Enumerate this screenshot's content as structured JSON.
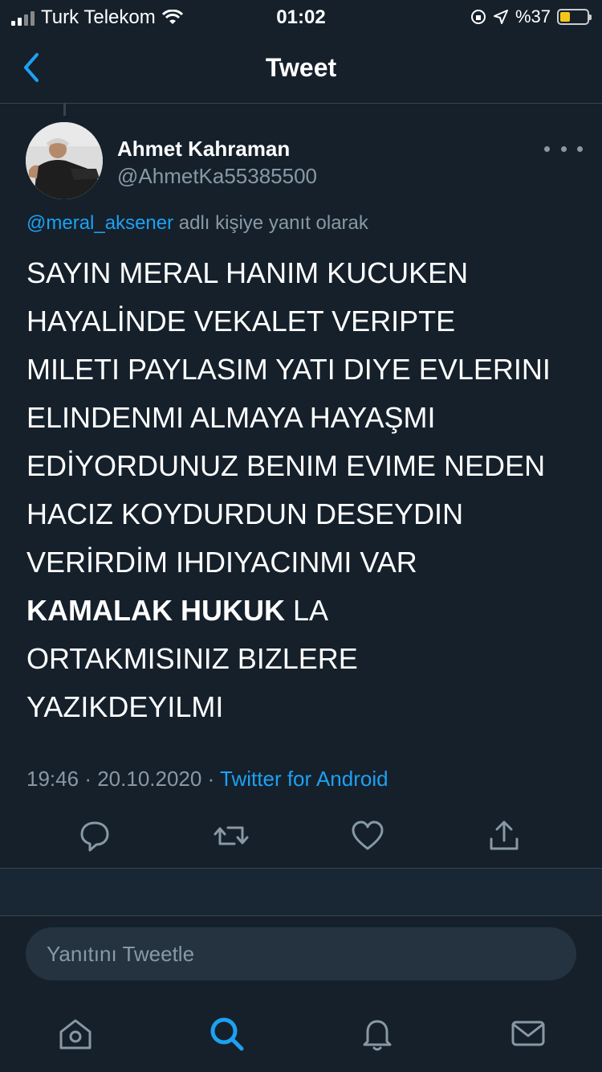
{
  "status_bar": {
    "carrier": "Turk Telekom",
    "time": "01:02",
    "battery": "%37",
    "battery_level": 0.37
  },
  "nav": {
    "back_icon": "chevron-left-icon",
    "title": "Tweet"
  },
  "tweet": {
    "author_name": "Ahmet Kahraman",
    "author_handle": "@AhmetKa55385500",
    "reply_mention": "@meral_aksener",
    "reply_suffix": "adlı kişiye yanıt olarak",
    "lines": [
      "SAYIN MERAL HANIM  KUCUKEN",
      "HAYALİNDE VEKALET VERIPTE",
      "MILETI PAYLASIM YATI DIYE EVLERINI",
      "ELINDENMI ALMAYA HAYAŞMI",
      "EDİYORDUNUZ BENIM EVIME NEDEN",
      "HACIZ KOYDURDUN DESEYDIN",
      "VERİRDİM IHDIYACINMI VAR"
    ],
    "bold_part": "KAMALAK HUKUK",
    "after_bold": " LA",
    "lines_end": [
      "ORTAKMISINIZ BIZLERE",
      "YAZIKDEYILMI"
    ],
    "time": "19:46",
    "separator": "·",
    "date": "20.10.2020",
    "source": "Twitter for Android"
  },
  "actions": [
    "reply-icon",
    "retweet-icon",
    "like-icon",
    "share-icon"
  ],
  "composer": {
    "placeholder": "Yanıtını Tweetle"
  },
  "tabbar": [
    "home-icon",
    "search-icon",
    "notifications-icon",
    "messages-icon"
  ],
  "colors": {
    "background": "#15202b",
    "accent": "#1da1f2",
    "secondary_text": "#8899a6",
    "divider": "#38444d",
    "battery_fill": "#f5c518"
  }
}
